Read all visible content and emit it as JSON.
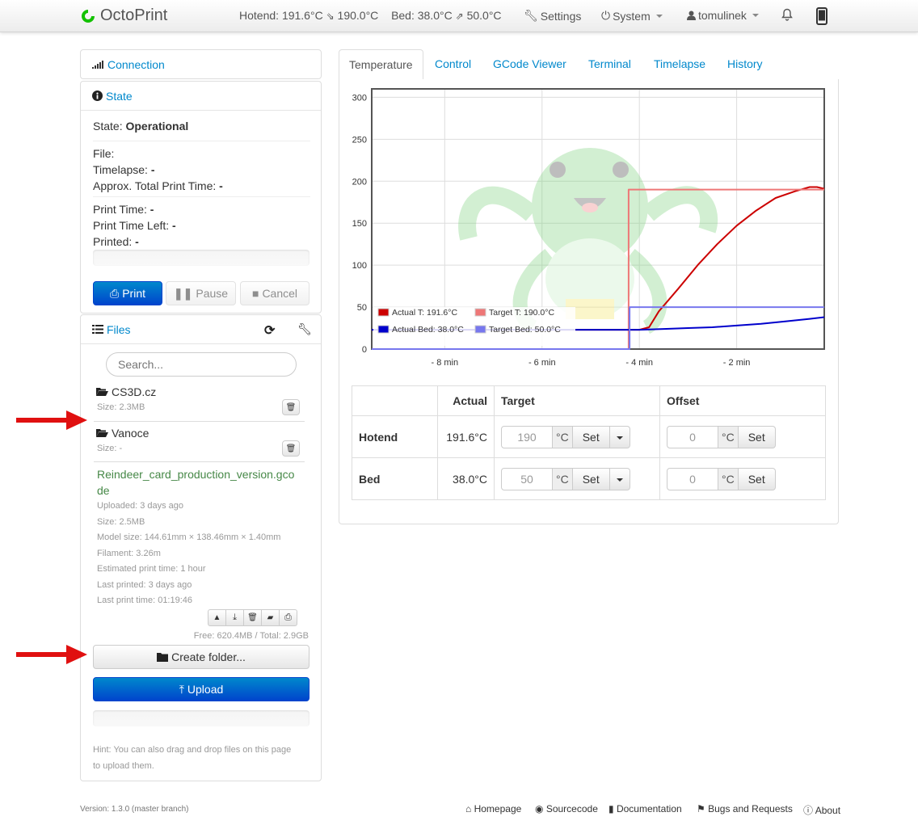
{
  "navbar": {
    "brand": "OctoPrint",
    "hotend_label": "Hotend:",
    "hotend_actual": "191.6°C",
    "hotend_target": "190.0°C",
    "bed_label": "Bed:",
    "bed_actual": "38.0°C",
    "bed_target": "50.0°C",
    "settings": "Settings",
    "system": "System",
    "user": "tomulinek"
  },
  "connection": {
    "title": "Connection"
  },
  "state": {
    "title": "State",
    "state_label": "State:",
    "state_value": "Operational",
    "file_label": "File:",
    "timelapse_label": "Timelapse:",
    "timelapse_value": "-",
    "approx_label": "Approx. Total Print Time:",
    "approx_value": "-",
    "print_time_label": "Print Time:",
    "print_time_value": "-",
    "time_left_label": "Print Time Left:",
    "time_left_value": "-",
    "printed_label": "Printed:",
    "printed_value": "-",
    "print_btn": "Print",
    "pause_btn": "Pause",
    "cancel_btn": "Cancel"
  },
  "files": {
    "title": "Files",
    "search_placeholder": "Search...",
    "folders": [
      {
        "name": "CS3D.cz",
        "size": "Size: 2.3MB"
      },
      {
        "name": "Vanoce",
        "size": "Size: -"
      }
    ],
    "file": {
      "name": "Reindeer_card_production_version.gco",
      "name_cont": "de",
      "uploaded": "Uploaded: 3 days ago",
      "size": "Size: 2.5MB",
      "model_size": "Model size: 144.61mm × 138.46mm × 1.40mm",
      "filament": "Filament: 3.26m",
      "est_time": "Estimated print time: 1 hour",
      "last_printed": "Last printed: 3 days ago",
      "last_print_time": "Last print time: 01:19:46"
    },
    "free": "Free: 620.4MB / Total: 2.9GB",
    "create_folder": "Create folder...",
    "upload": "Upload",
    "hint_1": "Hint: You can also drag and drop files on this page",
    "hint_2": "to upload them."
  },
  "tabs": [
    "Temperature",
    "Control",
    "GCode Viewer",
    "Terminal",
    "Timelapse",
    "History"
  ],
  "chart_data": {
    "type": "line",
    "xlim": [
      -9.5,
      -0.2
    ],
    "ylim": [
      0,
      310
    ],
    "yticks": [
      "0",
      "50",
      "100",
      "150",
      "200",
      "250",
      "300"
    ],
    "xticks": [
      "- 8 min",
      "- 6 min",
      "- 4 min",
      "- 2 min"
    ],
    "grid": true,
    "legend_position": "bottom-left",
    "series": [
      {
        "name": "Actual T: 191.6°C",
        "color": "#cc0000",
        "x": [
          -9.5,
          -4,
          -3.8,
          -3.6,
          -3.2,
          -2.8,
          -2.4,
          -2,
          -1.6,
          -1.2,
          -0.8,
          -0.5,
          -0.35,
          -0.2
        ],
        "y": [
          23,
          23,
          26,
          45,
          72,
          100,
          125,
          147,
          165,
          180,
          188,
          193,
          193,
          191
        ]
      },
      {
        "name": "Target T: 190.0°C",
        "color": "#ee7777",
        "x": [
          -9.5,
          -4.22,
          -4.22,
          -0.2
        ],
        "y": [
          0,
          0,
          190,
          190
        ]
      },
      {
        "name": "Actual Bed: 38.0°C",
        "color": "#0000cc",
        "x": [
          -9.5,
          -4,
          -3.5,
          -3,
          -2.5,
          -2,
          -1.5,
          -1,
          -0.5,
          -0.2
        ],
        "y": [
          23,
          23,
          24,
          25,
          26,
          28,
          30,
          33,
          36,
          38
        ]
      },
      {
        "name": "Target Bed: 50.0°C",
        "color": "#7777ee",
        "x": [
          -9.5,
          -4.2,
          -4.2,
          -0.2
        ],
        "y": [
          0,
          0,
          50,
          50
        ]
      }
    ]
  },
  "temp_table": {
    "col_actual": "Actual",
    "col_target": "Target",
    "col_offset": "Offset",
    "unit": "°C",
    "set": "Set",
    "rows": [
      {
        "label": "Hotend",
        "actual": "191.6°C",
        "target": "190",
        "offset": "0"
      },
      {
        "label": "Bed",
        "actual": "38.0°C",
        "target": "50",
        "offset": "0"
      }
    ]
  },
  "footer": {
    "version": "Version: 1.3.0 (master branch)",
    "homepage": "Homepage",
    "sourcecode": "Sourcecode",
    "documentation": "Documentation",
    "bugs": "Bugs and Requests",
    "about": "About"
  }
}
